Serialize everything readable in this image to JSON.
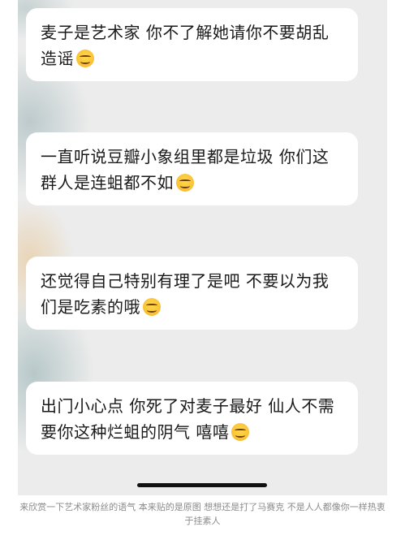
{
  "messages": [
    {
      "text": "麦子是艺术家 你不了解她请你不要胡乱造谣",
      "emoji": "smiling-face-icon"
    },
    {
      "text": "一直听说豆瓣小象组里都是垃圾 你们这群人是连蛆都不如",
      "emoji": "smiling-face-icon"
    },
    {
      "text": "还觉得自己特别有理了是吧 不要以为我们是吃素的哦",
      "emoji": "smiling-face-icon"
    },
    {
      "text": "出门小心点 你死了对麦子最好 仙人不需要你这种烂蛆的阴气 嘻嘻",
      "emoji": "smiling-face-icon"
    }
  ],
  "caption": "来欣赏一下艺术家粉丝的语气 本来贴的是原图 想想还是打了马赛克 不是人人都像你一样热衷于挂素人",
  "colors": {
    "background": "#ececec",
    "bubble": "#ffffff",
    "text": "#1a1a1a",
    "caption": "#8a8a8a"
  }
}
